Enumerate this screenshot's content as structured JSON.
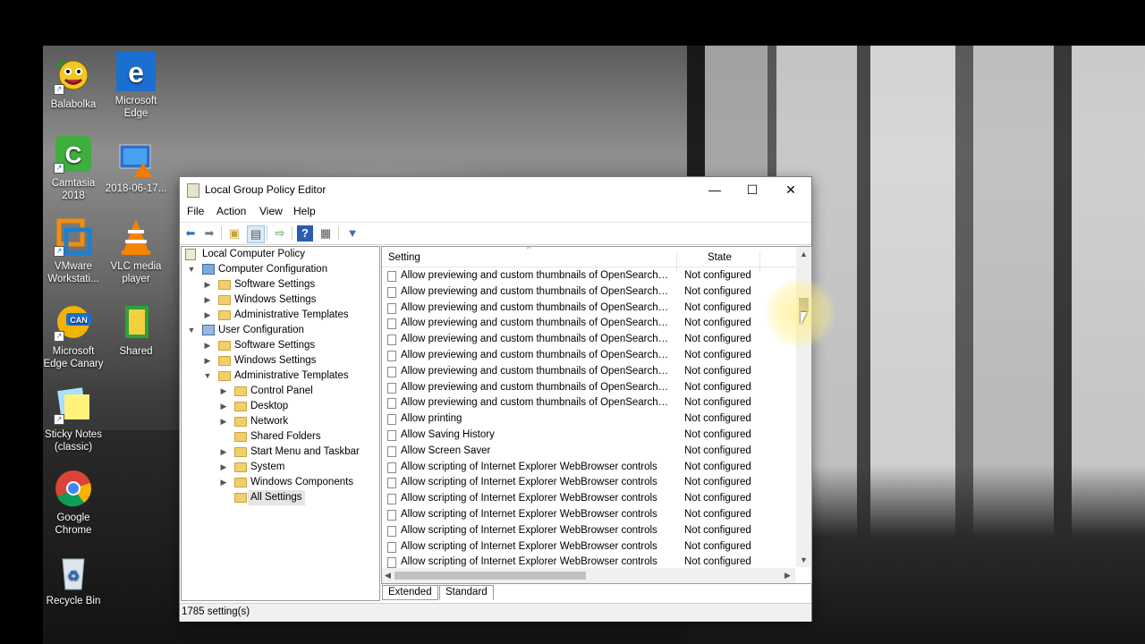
{
  "desktop_icons": [
    {
      "label": "Balabolka",
      "icon": "balabolka-icon"
    },
    {
      "label": "Microsoft Edge",
      "icon": "edge-icon"
    },
    {
      "label": "Camtasia 2018",
      "icon": "camtasia-icon"
    },
    {
      "label": "2018-06-17...",
      "icon": "video-file-icon"
    },
    {
      "label": "VMware Workstati...",
      "icon": "vmware-icon"
    },
    {
      "label": "VLC media player",
      "icon": "vlc-icon"
    },
    {
      "label": "Microsoft Edge Canary",
      "icon": "edge-canary-icon"
    },
    {
      "label": "Shared",
      "icon": "folder-icon"
    },
    {
      "label": "Sticky Notes (classic)",
      "icon": "sticky-notes-icon"
    },
    {
      "label": "Google Chrome",
      "icon": "chrome-icon"
    },
    {
      "label": "Recycle Bin",
      "icon": "recycle-bin-icon"
    }
  ],
  "window": {
    "title": "Local Group Policy Editor",
    "minimize": "—",
    "maximize": "☐",
    "close": "✕"
  },
  "menu": [
    "File",
    "Action",
    "View",
    "Help"
  ],
  "tree": [
    {
      "label": "Local Computer Policy"
    },
    {
      "label": "Computer Configuration"
    },
    {
      "label": "Software Settings"
    },
    {
      "label": "Windows Settings"
    },
    {
      "label": "Administrative Templates"
    },
    {
      "label": "User Configuration"
    },
    {
      "label": "Software Settings"
    },
    {
      "label": "Windows Settings"
    },
    {
      "label": "Administrative Templates"
    },
    {
      "label": "Control Panel"
    },
    {
      "label": "Desktop"
    },
    {
      "label": "Network"
    },
    {
      "label": "Shared Folders"
    },
    {
      "label": "Start Menu and Taskbar"
    },
    {
      "label": "System"
    },
    {
      "label": "Windows Components"
    },
    {
      "label": "All Settings"
    }
  ],
  "columns": {
    "setting": "Setting",
    "state": "State"
  },
  "rows": [
    {
      "setting": "Allow previewing and custom thumbnails of OpenSearch q...",
      "state": "Not configured"
    },
    {
      "setting": "Allow previewing and custom thumbnails of OpenSearch q...",
      "state": "Not configured"
    },
    {
      "setting": "Allow previewing and custom thumbnails of OpenSearch q...",
      "state": "Not configured"
    },
    {
      "setting": "Allow previewing and custom thumbnails of OpenSearch q...",
      "state": "Not configured"
    },
    {
      "setting": "Allow previewing and custom thumbnails of OpenSearch q...",
      "state": "Not configured"
    },
    {
      "setting": "Allow previewing and custom thumbnails of OpenSearch q...",
      "state": "Not configured"
    },
    {
      "setting": "Allow previewing and custom thumbnails of OpenSearch q...",
      "state": "Not configured"
    },
    {
      "setting": "Allow previewing and custom thumbnails of OpenSearch q...",
      "state": "Not configured"
    },
    {
      "setting": "Allow previewing and custom thumbnails of OpenSearch q...",
      "state": "Not configured"
    },
    {
      "setting": "Allow printing",
      "state": "Not configured"
    },
    {
      "setting": "Allow Saving History",
      "state": "Not configured"
    },
    {
      "setting": "Allow Screen Saver",
      "state": "Not configured"
    },
    {
      "setting": "Allow scripting of Internet Explorer WebBrowser controls",
      "state": "Not configured"
    },
    {
      "setting": "Allow scripting of Internet Explorer WebBrowser controls",
      "state": "Not configured"
    },
    {
      "setting": "Allow scripting of Internet Explorer WebBrowser controls",
      "state": "Not configured"
    },
    {
      "setting": "Allow scripting of Internet Explorer WebBrowser controls",
      "state": "Not configured"
    },
    {
      "setting": "Allow scripting of Internet Explorer WebBrowser controls",
      "state": "Not configured"
    },
    {
      "setting": "Allow scripting of Internet Explorer WebBrowser controls",
      "state": "Not configured"
    },
    {
      "setting": "Allow scripting of Internet Explorer WebBrowser controls",
      "state": "Not configured"
    }
  ],
  "tabs": [
    "Extended",
    "Standard"
  ],
  "status": "1785 setting(s)"
}
